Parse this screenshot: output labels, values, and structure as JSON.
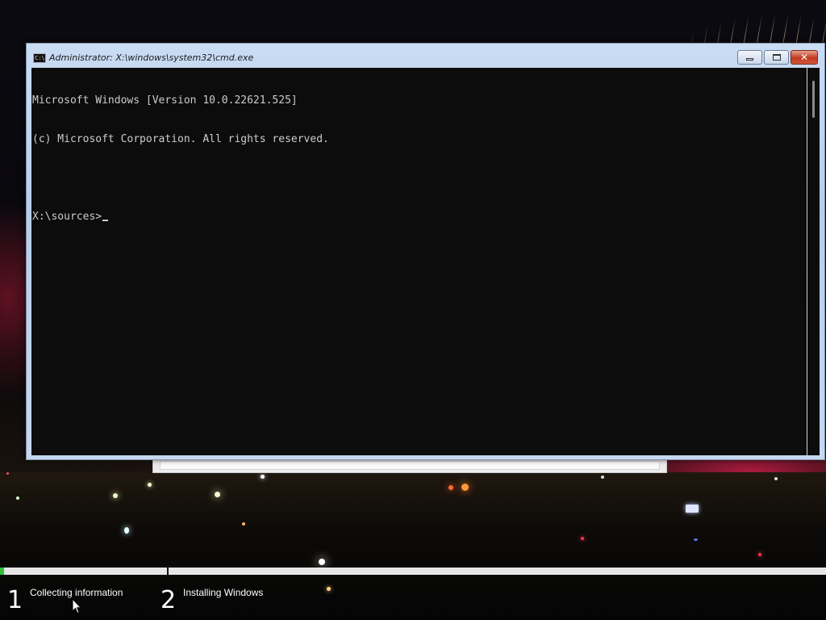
{
  "window": {
    "title": "Administrator: X:\\windows\\system32\\cmd.exe",
    "icon": "cmd-icon",
    "icon_text": "C:\\",
    "buttons": {
      "minimize": "minimize-icon",
      "maximize": "maximize-icon",
      "close": "✕"
    }
  },
  "console": {
    "lines": [
      "Microsoft Windows [Version 10.0.22621.525]",
      "(c) Microsoft Corporation. All rights reserved.",
      "",
      "X:\\sources>"
    ],
    "text_color": "#cccccc",
    "background": "#0c0c0c"
  },
  "setup": {
    "progress_fraction": 0.005,
    "progress_color": "#2fc23a",
    "steps": [
      {
        "number": "1",
        "label": "Collecting information"
      },
      {
        "number": "2",
        "label": "Installing Windows"
      }
    ]
  }
}
